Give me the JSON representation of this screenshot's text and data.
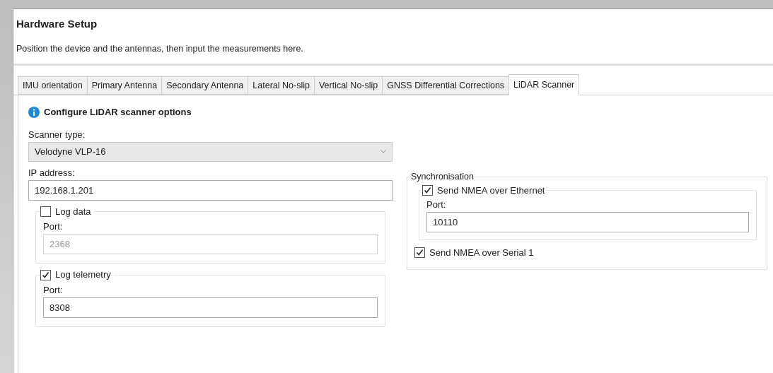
{
  "header": {
    "title": "Hardware Setup",
    "description": "Position the device and the antennas, then input the measurements here."
  },
  "tabs": [
    {
      "label": "IMU orientation",
      "selected": false
    },
    {
      "label": "Primary Antenna",
      "selected": false
    },
    {
      "label": "Secondary Antenna",
      "selected": false
    },
    {
      "label": "Lateral No-slip",
      "selected": false
    },
    {
      "label": "Vertical No-slip",
      "selected": false
    },
    {
      "label": "GNSS Differential Corrections",
      "selected": false
    },
    {
      "label": "LiDAR Scanner",
      "selected": true
    }
  ],
  "panel": {
    "info": "Configure LiDAR scanner options",
    "scanner_type": {
      "label": "Scanner type:",
      "value": "Velodyne VLP-16"
    },
    "ip_address": {
      "label": "IP address:",
      "value": "192.168.1.201"
    },
    "log_groups": [
      {
        "label": "Log data",
        "checked": false,
        "port_label": "Port:",
        "port": "2368"
      },
      {
        "label": "Log telemetry",
        "checked": true,
        "port_label": "Port:",
        "port": "8308"
      }
    ],
    "synchronisation": {
      "title": "Synchronisation",
      "ethernet": {
        "label": "Send NMEA over Ethernet",
        "checked": true,
        "port_label": "Port:",
        "port": "10110"
      },
      "serial": {
        "label": "Send NMEA over Serial 1",
        "checked": true
      }
    }
  }
}
